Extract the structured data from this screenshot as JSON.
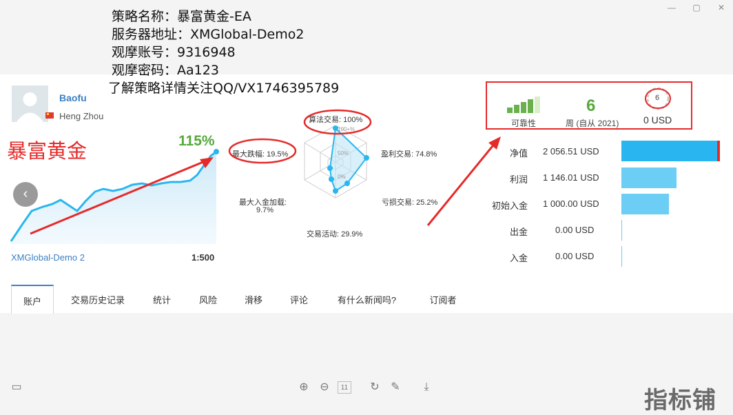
{
  "overlay": {
    "lines": [
      "策略名称：暴富黄金-EA",
      "服务器地址：XMGlobal-Demo2",
      "观摩账号：9316948",
      "观摩密码：Aa123",
      "了解策略详情关注QQ/VX1746395789"
    ]
  },
  "profile": {
    "name": "Baofu",
    "location": "Heng Zhou",
    "promo_title": "暴富黄金",
    "growth": "115%",
    "server": "XMGlobal-Demo 2",
    "leverage": "1:500"
  },
  "radar": {
    "algo": "算法交易: 100%",
    "profit_trades": "盈利交易: 74.8%",
    "loss_trades": "亏损交易: 25.2%",
    "activity": "交易活动: 29.9%",
    "max_deposit_load": "最大入金加载:",
    "max_deposit_load_val": "9.7%",
    "max_drawdown": "最大跌幅: 19.5%",
    "tick_100": "100+%",
    "tick_50": "50%",
    "tick_0": "0%"
  },
  "stats": {
    "reliability_label": "可靠性",
    "weeks_value": "6",
    "weeks_label": "周 (自从 2021)",
    "subscribers_badge": "6",
    "subscription_price": "0 USD"
  },
  "balances": [
    {
      "label": "净值",
      "value": "2 056.51 USD",
      "fraction": 1.0
    },
    {
      "label": "利润",
      "value": "1 146.01 USD",
      "fraction": 0.557
    },
    {
      "label": "初始入金",
      "value": "1 000.00 USD",
      "fraction": 0.486
    },
    {
      "label": "出金",
      "value": "0.00 USD",
      "fraction": 0.0
    },
    {
      "label": "入金",
      "value": "0.00 USD",
      "fraction": 0.0
    }
  ],
  "tabs": [
    "账户",
    "交易历史记录",
    "统计",
    "风险",
    "滑移",
    "评论",
    "有什么新闻吗?",
    "订阅者"
  ],
  "toolbar": {
    "page_number": "11"
  },
  "watermark": "指标铺",
  "colors": {
    "accent": "#3b7fc4",
    "green": "#55a93a",
    "red": "#e52a2a",
    "bar_primary": "#29b6f0",
    "bar_light": "#6ccdf5"
  }
}
